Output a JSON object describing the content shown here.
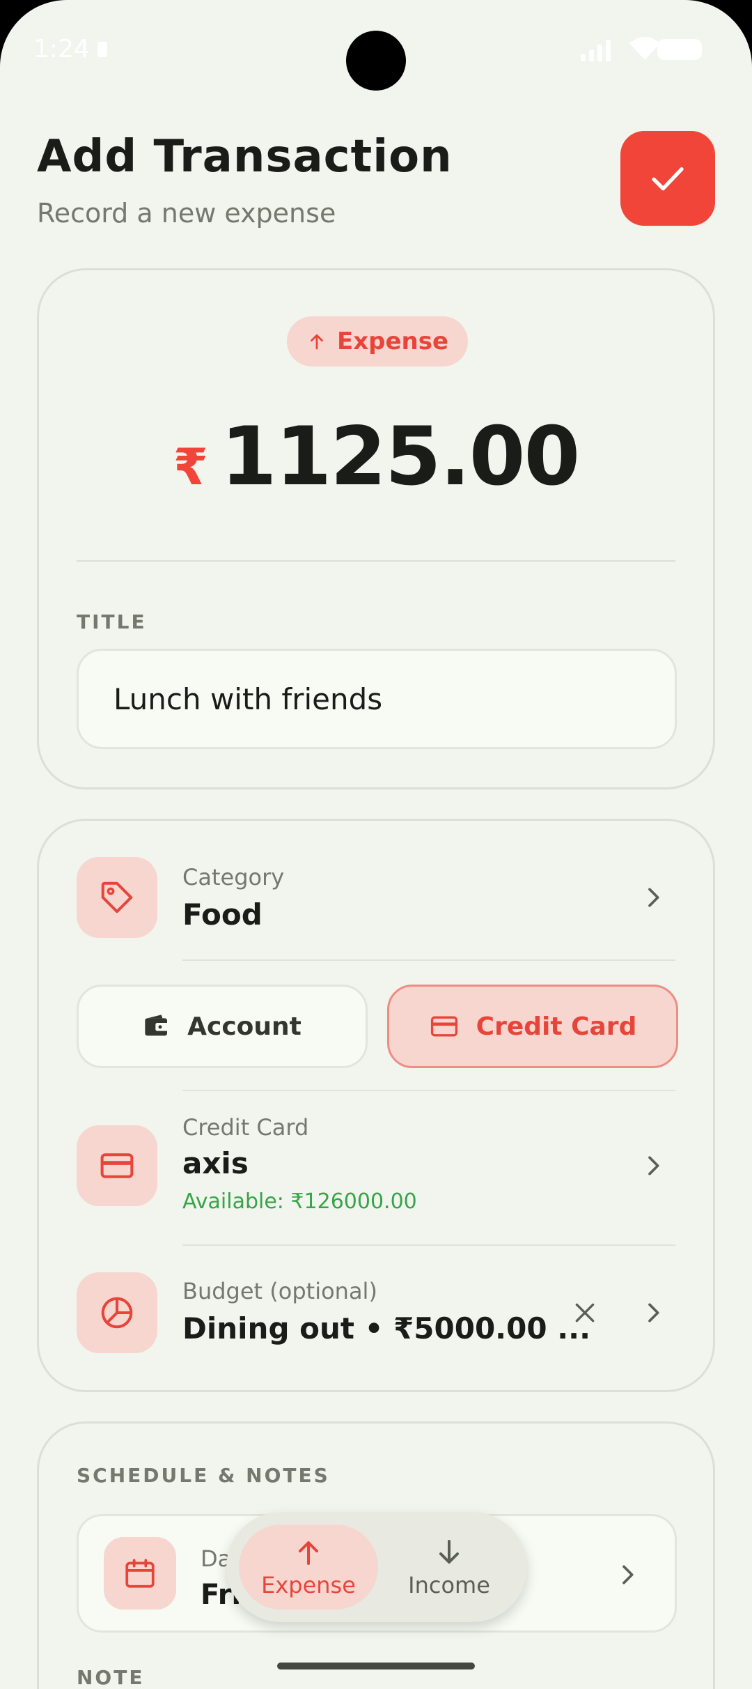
{
  "status_bar": {
    "time": "1:24"
  },
  "header": {
    "title": "Add Transaction",
    "subtitle": "Record a new expense"
  },
  "amount_card": {
    "type_chip": "Expense",
    "currency": "₹",
    "amount": "1125.00",
    "title_label": "TITLE",
    "title_value": "Lunch with friends"
  },
  "details_card": {
    "category_label": "Category",
    "category_value": "Food",
    "account_toggle": "Account",
    "credit_toggle": "Credit Card",
    "card_label": "Credit Card",
    "card_value": "axis",
    "card_available": "Available: ₹126000.00",
    "budget_label": "Budget (optional)",
    "budget_value": "Dining out • ₹5000.00 ..."
  },
  "schedule_card": {
    "section_label": "SCHEDULE & NOTES",
    "date_label": "Date",
    "date_value": "Fri",
    "note_label": "NOTE"
  },
  "switcher": {
    "expense": "Expense",
    "income": "Income"
  },
  "colors": {
    "accent": "#f2453a",
    "accent_soft": "#f6d6cf",
    "background": "#f2f4ee",
    "available_green": "#35a548"
  }
}
